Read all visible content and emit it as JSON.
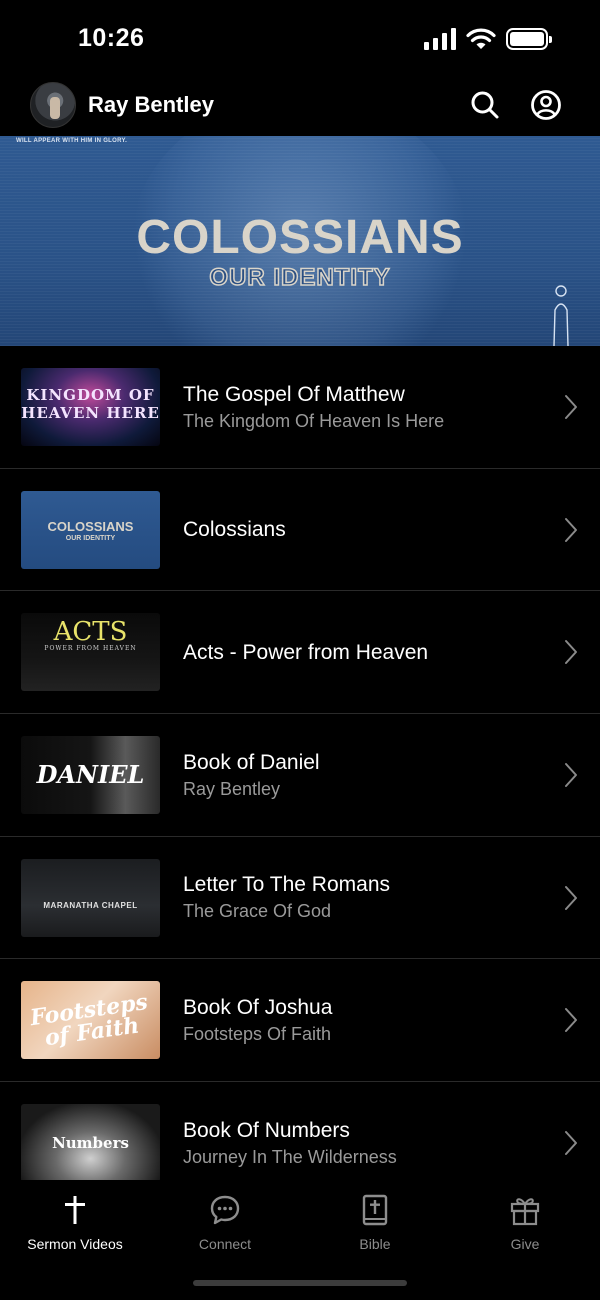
{
  "status_bar": {
    "time": "10:26"
  },
  "header": {
    "title": "Ray Bentley"
  },
  "hero": {
    "top_text": "WILL APPEAR WITH HIM IN GLORY.",
    "title": "COLOSSIANS",
    "subtitle": "OUR IDENTITY"
  },
  "series": [
    {
      "title": "The Gospel Of Matthew",
      "subtitle": "The Kingdom Of Heaven Is Here",
      "thumb_text": "KINGDOM OF HEAVEN HERE",
      "thumb_icon": "matthew-thumbnail"
    },
    {
      "title": "Colossians",
      "subtitle": "",
      "thumb_text": "COLOSSIANS",
      "thumb_subtext": "OUR IDENTITY",
      "thumb_icon": "colossians-thumbnail"
    },
    {
      "title": "Acts - Power from Heaven",
      "subtitle": "",
      "thumb_text": "ACTS",
      "thumb_subtext": "POWER FROM HEAVEN",
      "thumb_icon": "acts-thumbnail"
    },
    {
      "title": "Book of Daniel",
      "subtitle": "Ray Bentley",
      "thumb_text": "DANIEL",
      "thumb_icon": "daniel-thumbnail"
    },
    {
      "title": "Letter To The Romans",
      "subtitle": "The Grace Of God",
      "thumb_text": "MARANATHA CHAPEL",
      "thumb_icon": "romans-thumbnail"
    },
    {
      "title": "Book Of Joshua",
      "subtitle": "Footsteps Of Faith",
      "thumb_text": "Footsteps of Faith",
      "thumb_icon": "joshua-thumbnail"
    },
    {
      "title": "Book Of Numbers",
      "subtitle": "Journey In The Wilderness",
      "thumb_text": "Numbers",
      "thumb_icon": "numbers-thumbnail"
    }
  ],
  "tabs": [
    {
      "label": "Sermon Videos",
      "icon": "cross-icon",
      "active": true
    },
    {
      "label": "Connect",
      "icon": "chat-bubble-icon",
      "active": false
    },
    {
      "label": "Bible",
      "icon": "bible-icon",
      "active": false
    },
    {
      "label": "Give",
      "icon": "gift-icon",
      "active": false
    }
  ],
  "colors": {
    "background": "#000000",
    "hero_blue": "#2f5a92",
    "subtitle_gray": "#9a9a9a",
    "tab_inactive": "#8d8d8d"
  }
}
